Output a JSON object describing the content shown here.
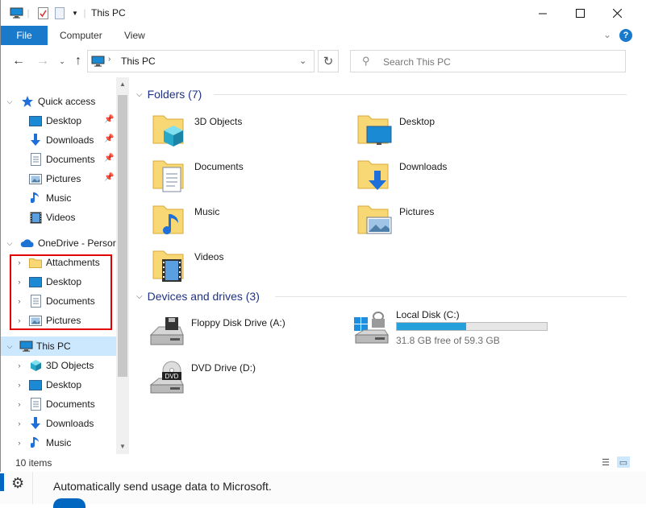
{
  "window": {
    "title": "This PC"
  },
  "ribbon": {
    "tabs": [
      "File",
      "Computer",
      "View"
    ]
  },
  "address": {
    "location": "This PC",
    "search_placeholder": "Search This PC"
  },
  "nav": {
    "quick_access": "Quick access",
    "quick_items": [
      "Desktop",
      "Downloads",
      "Documents",
      "Pictures",
      "Music",
      "Videos"
    ],
    "onedrive": "OneDrive - Persor",
    "onedrive_items": [
      "Attachments",
      "Desktop",
      "Documents",
      "Pictures"
    ],
    "this_pc": "This PC",
    "pc_items": [
      "3D Objects",
      "Desktop",
      "Documents",
      "Downloads",
      "Music"
    ]
  },
  "content": {
    "folders_heading": "Folders (7)",
    "folders": [
      "3D Objects",
      "Desktop",
      "Documents",
      "Downloads",
      "Music",
      "Pictures",
      "Videos"
    ],
    "devices_heading": "Devices and drives (3)",
    "drives": [
      {
        "name": "Floppy Disk Drive (A:)"
      },
      {
        "name": "Local Disk (C:)",
        "free_text": "31.8 GB free of 59.3 GB",
        "used_fraction": 0.46
      },
      {
        "name": "DVD Drive (D:)"
      }
    ]
  },
  "status": {
    "count": "10 items"
  },
  "background": {
    "setting_text": "Automatically send usage data to Microsoft."
  },
  "colors": {
    "accent": "#1979ca",
    "selection": "#cce8ff",
    "drive_bar": "#26a0da",
    "highlight_box": "#e00000"
  }
}
